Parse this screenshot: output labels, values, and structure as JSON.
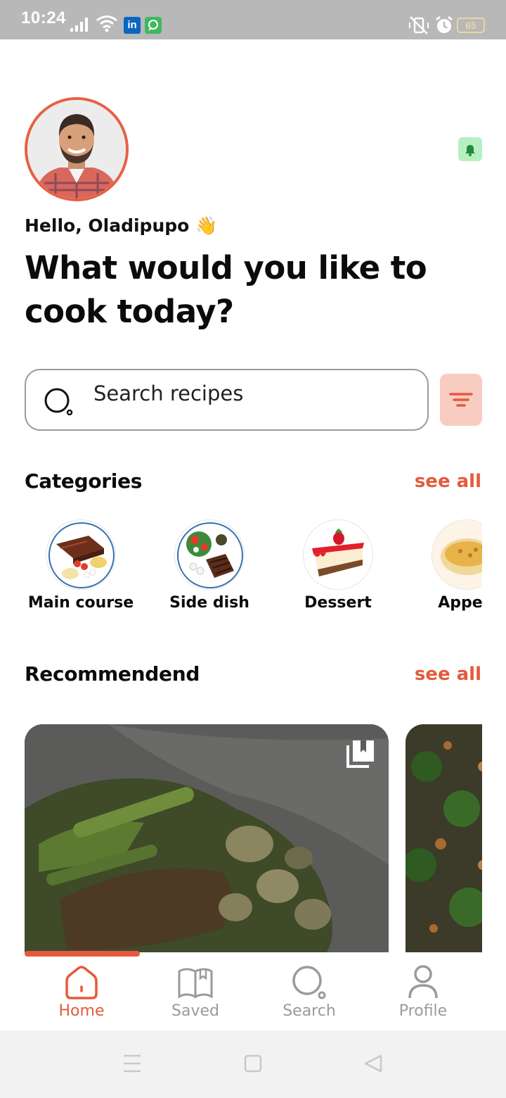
{
  "status_bar": {
    "time": "10:24",
    "battery": "65",
    "icons": [
      "signal-icon",
      "wifi-icon",
      "linkedin-icon",
      "chat-icon",
      "vibrate-mute-icon",
      "alarm-icon",
      "battery-icon"
    ],
    "linkedin_glyph": "in"
  },
  "header": {
    "greeting": "Hello, Oladipupo 👋",
    "headline": "What would you like to cook today?",
    "notification_icon": "bell-icon"
  },
  "search": {
    "placeholder": "Search recipes",
    "icon": "search-icon",
    "filter_icon": "filter-icon"
  },
  "categories": {
    "title": "Categories",
    "see_all": "see all",
    "items": [
      {
        "label": "Main course"
      },
      {
        "label": "Side dish"
      },
      {
        "label": "Dessert"
      },
      {
        "label": "Appeti"
      }
    ]
  },
  "recommended": {
    "title": "Recommendend",
    "see_all": "see all",
    "cards": [
      {
        "icon": "bookmark-icon"
      },
      {}
    ],
    "scroll_progress": 0.25
  },
  "bottom_nav": {
    "active": "Home",
    "items": [
      {
        "label": "Home",
        "icon": "home-icon"
      },
      {
        "label": "Saved",
        "icon": "book-icon"
      },
      {
        "label": "Search",
        "icon": "search-icon"
      },
      {
        "label": "Profile",
        "icon": "user-icon"
      }
    ]
  },
  "colors": {
    "accent": "#e55a3c",
    "filter_bg": "#f9ccc1",
    "bell_bg": "#b6f0c0",
    "nav_inactive": "#9a9a9a"
  }
}
